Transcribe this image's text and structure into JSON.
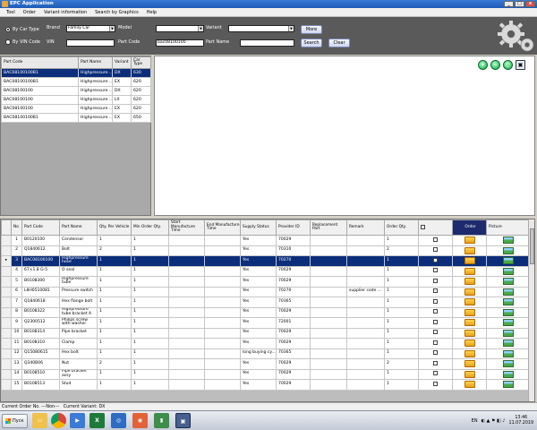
{
  "window": {
    "title": "EPC Application"
  },
  "menu": [
    "Tool",
    "Order",
    "Variant information",
    "Search by Graphics",
    "Help"
  ],
  "search": {
    "by_car_type_label": "By Car Type",
    "by_vin_code_label": "By VIN Code",
    "brand_label": "Brand",
    "brand_value": "Family Car",
    "model_label": "Model",
    "model_value": "",
    "variant_label": "Variant",
    "variant_value": "",
    "vin_label": "VIN",
    "vin_value": "",
    "part_code_label": "Part Code",
    "part_code_value": "bac08100100",
    "part_name_label": "Part Name",
    "part_name_value": "",
    "more_label": "More",
    "search_label": "Search",
    "clear_label": "Clear"
  },
  "results": {
    "headers": [
      "Part Code",
      "Part Name",
      "Variant",
      "Car Type"
    ],
    "rows": [
      [
        "BAC08100100B1",
        "Highpressure ...",
        "DX",
        "630"
      ],
      [
        "BAC08100100B1",
        "Highpressure ...",
        "EX",
        "620"
      ],
      [
        "BAC08100100",
        "Highpressure ...",
        "DX",
        "620"
      ],
      [
        "BAC08100100",
        "Highpressure ...",
        "LX",
        "620"
      ],
      [
        "BAC08100100",
        "Highpressure ...",
        "EX",
        "620"
      ],
      [
        "BAC08100100B1",
        "Highpressure ...",
        "EX",
        "650"
      ]
    ]
  },
  "nav_icons": [
    "+",
    "−",
    "○",
    "▣"
  ],
  "parts": {
    "headers": [
      "No",
      "Part Code",
      "Part Name",
      "Qty. Per Vehicle",
      "Min Order Qty.",
      "Start Manufacture Time",
      "End Manufacture Time",
      "Supply Status",
      "Provider ID",
      "Replacement Part",
      "Remark",
      "Order Qty.",
      "",
      "Order",
      "Picture"
    ],
    "rows": [
      [
        "1",
        "B0120100",
        "Condensor",
        "1",
        "1",
        "",
        "",
        "Yes",
        "70029",
        "",
        "",
        "1"
      ],
      [
        "2",
        "Q1840612",
        "Bolt",
        "2",
        "1",
        "",
        "",
        "Yes",
        "70310",
        "",
        "",
        "2"
      ],
      [
        "3",
        "BAC08100100",
        "Highpressure hose",
        "1",
        "1",
        "",
        "",
        "Yes",
        "70270",
        "",
        "",
        "1"
      ],
      [
        "4",
        "67×1.8 G-5",
        "O seal",
        "1",
        "1",
        "",
        "",
        "Yes",
        "70029",
        "",
        "",
        "1"
      ],
      [
        "5",
        "B0108300",
        "Highpressure tube",
        "1",
        "1",
        "",
        "",
        "Yes",
        "70029",
        "",
        "",
        "1"
      ],
      [
        "6",
        "L8H0510081",
        "Pressure switch",
        "1",
        "1",
        "",
        "",
        "Yes",
        "70270",
        "",
        "supplier code ...",
        "1"
      ],
      [
        "7",
        "Q1840618",
        "Hex flange bolt",
        "1",
        "1",
        "",
        "",
        "Yes",
        "70365",
        "",
        "",
        "1"
      ],
      [
        "8",
        "B0108322",
        "Highpressure tube bracket A",
        "1",
        "1",
        "",
        "",
        "Yes",
        "70029",
        "",
        "",
        "1"
      ],
      [
        "9",
        "Q2300512",
        "Philips screw with washer",
        "1",
        "1",
        "",
        "",
        "Yes",
        "72001",
        "",
        "",
        "1"
      ],
      [
        "10",
        "B0108314",
        "Pipe bracket",
        "1",
        "1",
        "",
        "",
        "Yes",
        "70029",
        "",
        "",
        "1"
      ],
      [
        "11",
        "B0108310",
        "Clamp",
        "1",
        "1",
        "",
        "",
        "Yes",
        "70029",
        "",
        "",
        "1"
      ],
      [
        "12",
        "Q15080615",
        "Hex bolt",
        "1",
        "1",
        "",
        "",
        "long buying cy...",
        "70365",
        "",
        "",
        "1"
      ],
      [
        "13",
        "Q340B06",
        "Nut",
        "2",
        "1",
        "",
        "",
        "Yes",
        "70029",
        "",
        "",
        "2"
      ],
      [
        "14",
        "B0108510",
        "Pipe bracket assy",
        "1",
        "1",
        "",
        "",
        "Yes",
        "70029",
        "",
        "",
        "1"
      ],
      [
        "15",
        "B0108513",
        "Stud",
        "1",
        "1",
        "",
        "",
        "Yes",
        "70029",
        "",
        "",
        "1"
      ]
    ]
  },
  "status": {
    "order_no_label": "Current Order No.",
    "order_no_value": "---Non---",
    "variant_label": "Current Variant:",
    "variant_value": "DX"
  },
  "taskbar": {
    "start_label": "Пуск",
    "lang": "EN",
    "time": "13:46",
    "date": "11.07.2019"
  }
}
